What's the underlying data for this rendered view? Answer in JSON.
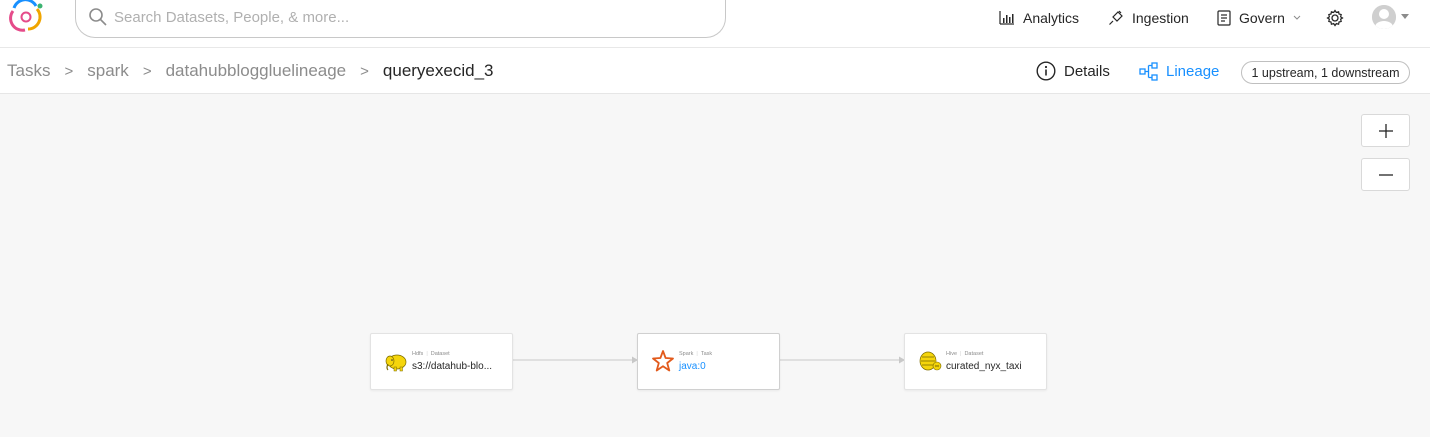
{
  "header": {
    "search_placeholder": "Search Datasets, People, & more...",
    "nav": [
      {
        "label": "Analytics",
        "icon": "bar-chart-icon"
      },
      {
        "label": "Ingestion",
        "icon": "plug-icon"
      },
      {
        "label": "Govern",
        "icon": "clipboard-icon"
      }
    ],
    "settings_icon": "gear-icon",
    "avatar_icon": "user-avatar-icon"
  },
  "breadcrumb": {
    "items": [
      "Tasks",
      "spark",
      "datahubbloggluelineage"
    ],
    "current": "queryexecid_3",
    "separator": ">"
  },
  "tabs": {
    "details": "Details",
    "lineage": "Lineage",
    "lineage_count": "1 upstream, 1 downstream"
  },
  "canvas": {
    "zoom_in": "+",
    "zoom_out": "−",
    "nodes": [
      {
        "platform": "Hdfs",
        "type": "Dataset",
        "name": "s3://datahub-blo...",
        "icon": "hadoop-elephant-icon"
      },
      {
        "platform": "Spark",
        "type": "Task",
        "name": "java:0",
        "icon": "spark-star-icon"
      },
      {
        "platform": "Hive",
        "type": "Dataset",
        "name": "curated_nyx_taxi",
        "icon": "hive-bee-icon"
      }
    ]
  },
  "colors": {
    "accent": "#1890ff",
    "spark": "#e25a1c",
    "hadoop": "#f5d50c"
  }
}
